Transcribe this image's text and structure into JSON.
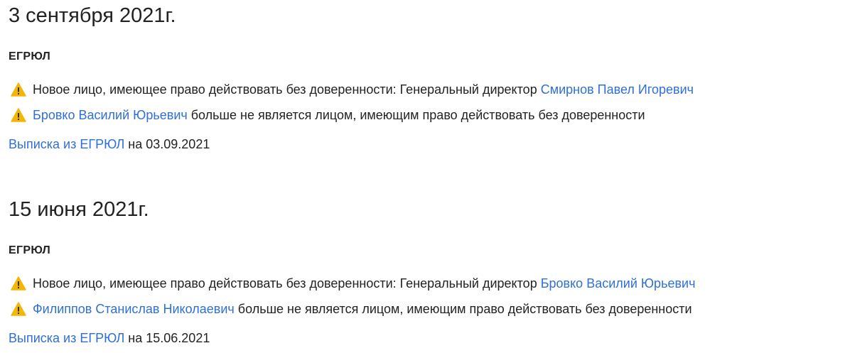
{
  "entries": [
    {
      "date": "3 сентября 2021г.",
      "source": "ЕГРЮЛ",
      "events": [
        {
          "prefix": "Новое лицо, имеющее право действовать без доверенности: Генеральный директор ",
          "person": "Смирнов Павел Игоревич",
          "suffix": ""
        },
        {
          "prefix": "",
          "person": "Бровко Василий Юрьевич",
          "suffix": " больше не является лицом, имеющим право действовать без доверенности"
        }
      ],
      "extract_link": "Выписка из ЕГРЮЛ",
      "extract_suffix": " на 03.09.2021"
    },
    {
      "date": "15 июня 2021г.",
      "source": "ЕГРЮЛ",
      "events": [
        {
          "prefix": "Новое лицо, имеющее право действовать без доверенности: Генеральный директор ",
          "person": "Бровко Василий Юрьевич",
          "suffix": ""
        },
        {
          "prefix": "",
          "person": "Филиппов Станислав Николаевич",
          "suffix": " больше не является лицом, имеющим право действовать без доверенности"
        }
      ],
      "extract_link": "Выписка из ЕГРЮЛ",
      "extract_suffix": " на 15.06.2021"
    }
  ],
  "icons": {
    "warning": "warning-triangle-icon"
  },
  "colors": {
    "link": "#2f6fd9",
    "warning": "#f2b705",
    "text": "#222222"
  }
}
